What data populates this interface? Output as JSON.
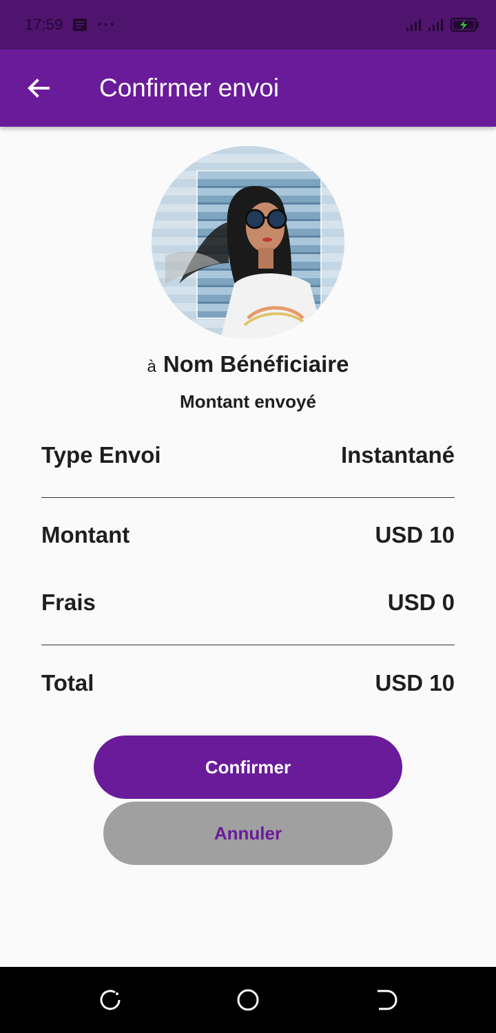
{
  "status_bar": {
    "time": "17:59",
    "icons": [
      "message-icon",
      "more-dots-icon",
      "signal-icon",
      "signal-icon",
      "battery-charging-icon"
    ],
    "dots": "···"
  },
  "app_bar": {
    "title": "Confirmer envoi",
    "back_icon": "arrow-left-icon",
    "color": "#6a1b9a"
  },
  "recipient": {
    "prefix": "à",
    "name": "Nom Bénéficiaire",
    "amount_caption": "Montant envoyé"
  },
  "details": {
    "type_label": "Type Envoi",
    "type_value": "Instantané",
    "amount_label": "Montant",
    "amount_value": "USD 10",
    "fees_label": "Frais",
    "fees_value": "USD 0",
    "total_label": "Total",
    "total_value": "USD 10"
  },
  "actions": {
    "confirm_label": "Confirmer",
    "cancel_label": "Annuler"
  },
  "nav_bar": {
    "icons": [
      "recent-apps-icon",
      "home-icon",
      "back-icon"
    ]
  }
}
